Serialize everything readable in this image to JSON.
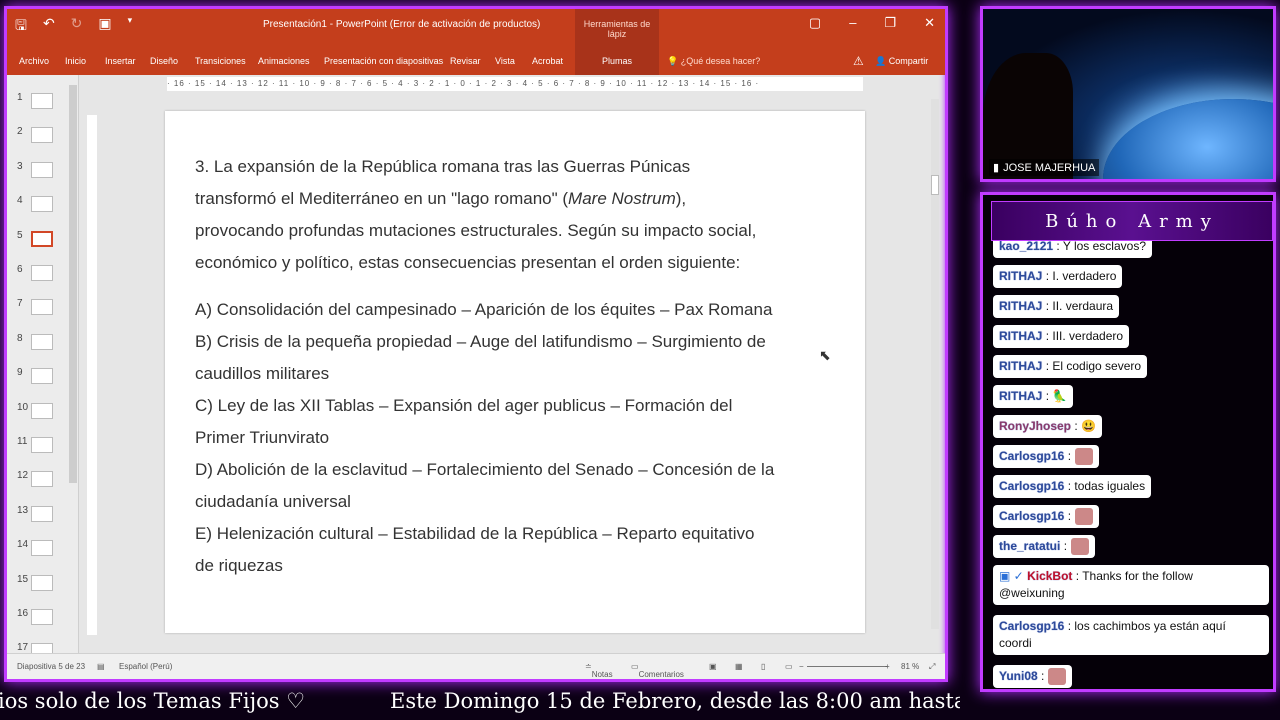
{
  "powerpoint": {
    "window_title": "Presentación1 - PowerPoint (Error de activación de productos)",
    "tools_title": "Herramientas de lápiz",
    "tabs": [
      "Archivo",
      "Inicio",
      "Insertar",
      "Diseño",
      "Transiciones",
      "Animaciones",
      "Presentación con diapositivas",
      "Revisar",
      "Vista",
      "Acrobat",
      "Plumas"
    ],
    "search_placeholder": "¿Qué desea hacer?",
    "share_label": "Compartir",
    "ruler_text": "· 16 · 15 · 14 · 13 · 12 · 11 · 10 · 9 · 8 · 7 · 6 · 5 · 4 · 3 · 2 · 1 · 0 · 1 · 2 · 3 · 4 · 5 · 6 · 7 · 8 · 9 · 10 · 11 · 12 · 13 · 14 · 15 · 16 ·",
    "thumbnails": [
      "1",
      "2",
      "3",
      "4",
      "5",
      "6",
      "7",
      "8",
      "9",
      "10",
      "11",
      "12",
      "13",
      "14",
      "15",
      "16",
      "17"
    ],
    "active_slide": 5,
    "slide": {
      "question_pre": "3. La expansión de la República romana tras las Guerras Púnicas transformó el Mediterráneo en un \"lago romano\" (",
      "question_italic": "Mare Nostrum",
      "question_post": "), provocando profundas mutaciones estructurales. Según su impacto social, económico y político, estas consecuencias presentan el orden siguiente:",
      "options": [
        "A) Consolidación del campesinado – Aparición de los équites – Pax Romana",
        "B) Crisis de la pequeña propiedad – Auge del latifundismo – Surgimiento de caudillos militares",
        "C) Ley de las XII Tablas – Expansión del ager publicus – Formación del Primer Triunvirato",
        "D) Abolición de la esclavitud – Fortalecimiento del Senado – Concesión de la ciudadanía universal",
        "E) Helenización cultural – Estabilidad de la República – Reparto equitativo de riquezas"
      ]
    },
    "status": {
      "slide_info": "Diapositiva 5 de 23",
      "language": "Español (Perú)",
      "notes": "Notas",
      "comments": "Comentarios",
      "zoom": "81 %"
    }
  },
  "camera": {
    "name": "JOSE MAJERHUA"
  },
  "chat": {
    "title": "Búho Army",
    "messages": [
      {
        "user": "kao_2121",
        "text": ": Y los esclavos?",
        "color": "#2d4a9a"
      },
      {
        "user": "RITHAJ",
        "text": ": I. verdadero"
      },
      {
        "user": "RITHAJ",
        "text": ": II. verdaura"
      },
      {
        "user": "RITHAJ",
        "text": ": III. verdadero"
      },
      {
        "user": "RITHAJ",
        "text": ": El codigo severo"
      },
      {
        "user": "RITHAJ",
        "text": ": 🦜"
      },
      {
        "user": "RonyJhosep",
        "text": ": 😃"
      },
      {
        "user": "Carlosgp16",
        "text": ":"
      },
      {
        "user": "Carlosgp16",
        "text": ": todas iguales"
      },
      {
        "user": "Carlosgp16",
        "text": ":"
      },
      {
        "user": "the_ratatui",
        "text": ":"
      },
      {
        "user": "KickBot",
        "text": ": Thanks for the follow",
        "text2": "@weixuning"
      },
      {
        "user": "Carlosgp16",
        "text": ": los cachimbos ya están aquí",
        "text2": "coordi"
      },
      {
        "user": "Yuni08",
        "text": ":"
      }
    ]
  },
  "ticker": {
    "left": "ios solo de los Temas Fijos ♡",
    "right": "Este Domingo 15 de Febrero, desde las 8:00 am hasta las"
  },
  "colors": {
    "accent": "#c13cff",
    "ppt_brand": "#c43e1c"
  }
}
